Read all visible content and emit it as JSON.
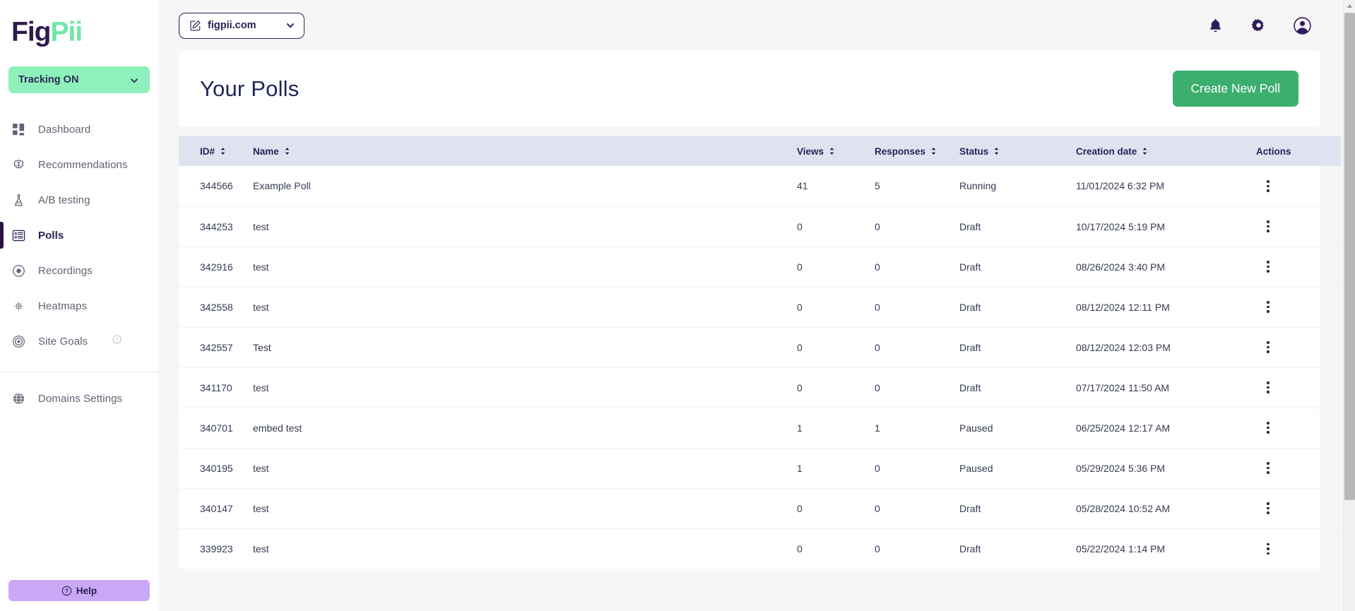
{
  "brand": {
    "name_part1": "Fig",
    "name_part2": "Pii",
    "color1": "#2e1a4d",
    "color2": "#6ee7a8"
  },
  "sidebar": {
    "tracking": {
      "label": "Tracking ON",
      "bg": "#8ef0bb"
    },
    "items": [
      {
        "label": "Dashboard",
        "icon": "dashboard-icon",
        "active": false
      },
      {
        "label": "Recommendations",
        "icon": "brain-icon",
        "active": false
      },
      {
        "label": "A/B testing",
        "icon": "flask-icon",
        "active": false
      },
      {
        "label": "Polls",
        "icon": "poll-list-icon",
        "active": true
      },
      {
        "label": "Recordings",
        "icon": "record-circle-icon",
        "active": false
      },
      {
        "label": "Heatmaps",
        "icon": "heatmap-dots-icon",
        "active": false
      },
      {
        "label": "Site Goals",
        "icon": "target-icon",
        "active": false,
        "help": "?"
      }
    ],
    "footer_items": [
      {
        "label": "Domains Settings",
        "icon": "globe-icon"
      }
    ],
    "help_button": {
      "label": "Help",
      "icon": "question-circle-icon",
      "bg": "#c9a9f5"
    }
  },
  "topbar": {
    "domain_selector": {
      "value": "figpii.com",
      "icon": "edit-square-icon",
      "chevron": "chevron-down-icon"
    },
    "icons": [
      {
        "name": "bell-icon",
        "label": "Notifications"
      },
      {
        "name": "gear-icon",
        "label": "Settings"
      },
      {
        "name": "user-avatar-icon",
        "label": "Account"
      }
    ]
  },
  "main": {
    "title": "Your Polls",
    "create_button": {
      "label": "Create New Poll",
      "color": "#3cae6e"
    },
    "table": {
      "columns": [
        {
          "key": "id",
          "label": "ID#",
          "sortable": true
        },
        {
          "key": "name",
          "label": "Name",
          "sortable": true
        },
        {
          "key": "views",
          "label": "Views",
          "sortable": true
        },
        {
          "key": "responses",
          "label": "Responses",
          "sortable": true
        },
        {
          "key": "status",
          "label": "Status",
          "sortable": true
        },
        {
          "key": "created",
          "label": "Creation date",
          "sortable": true
        },
        {
          "key": "actions",
          "label": "Actions",
          "sortable": false
        }
      ],
      "rows": [
        {
          "id": "344566",
          "name": "Example Poll",
          "views": "41",
          "responses": "5",
          "status": "Running",
          "created": "11/01/2024 6:32 PM"
        },
        {
          "id": "344253",
          "name": "test",
          "views": "0",
          "responses": "0",
          "status": "Draft",
          "created": "10/17/2024 5:19 PM"
        },
        {
          "id": "342916",
          "name": "test",
          "views": "0",
          "responses": "0",
          "status": "Draft",
          "created": "08/26/2024 3:40 PM"
        },
        {
          "id": "342558",
          "name": "test",
          "views": "0",
          "responses": "0",
          "status": "Draft",
          "created": "08/12/2024 12:11 PM"
        },
        {
          "id": "342557",
          "name": "Test",
          "views": "0",
          "responses": "0",
          "status": "Draft",
          "created": "08/12/2024 12:03 PM"
        },
        {
          "id": "341170",
          "name": "test",
          "views": "0",
          "responses": "0",
          "status": "Draft",
          "created": "07/17/2024 11:50 AM"
        },
        {
          "id": "340701",
          "name": "embed test",
          "views": "1",
          "responses": "1",
          "status": "Paused",
          "created": "06/25/2024 12:17 AM"
        },
        {
          "id": "340195",
          "name": "test",
          "views": "1",
          "responses": "0",
          "status": "Paused",
          "created": "05/29/2024 5:36 PM"
        },
        {
          "id": "340147",
          "name": "test",
          "views": "0",
          "responses": "0",
          "status": "Draft",
          "created": "05/28/2024 10:52 AM"
        },
        {
          "id": "339923",
          "name": "test",
          "views": "0",
          "responses": "0",
          "status": "Draft",
          "created": "05/22/2024 1:14 PM"
        }
      ]
    }
  }
}
